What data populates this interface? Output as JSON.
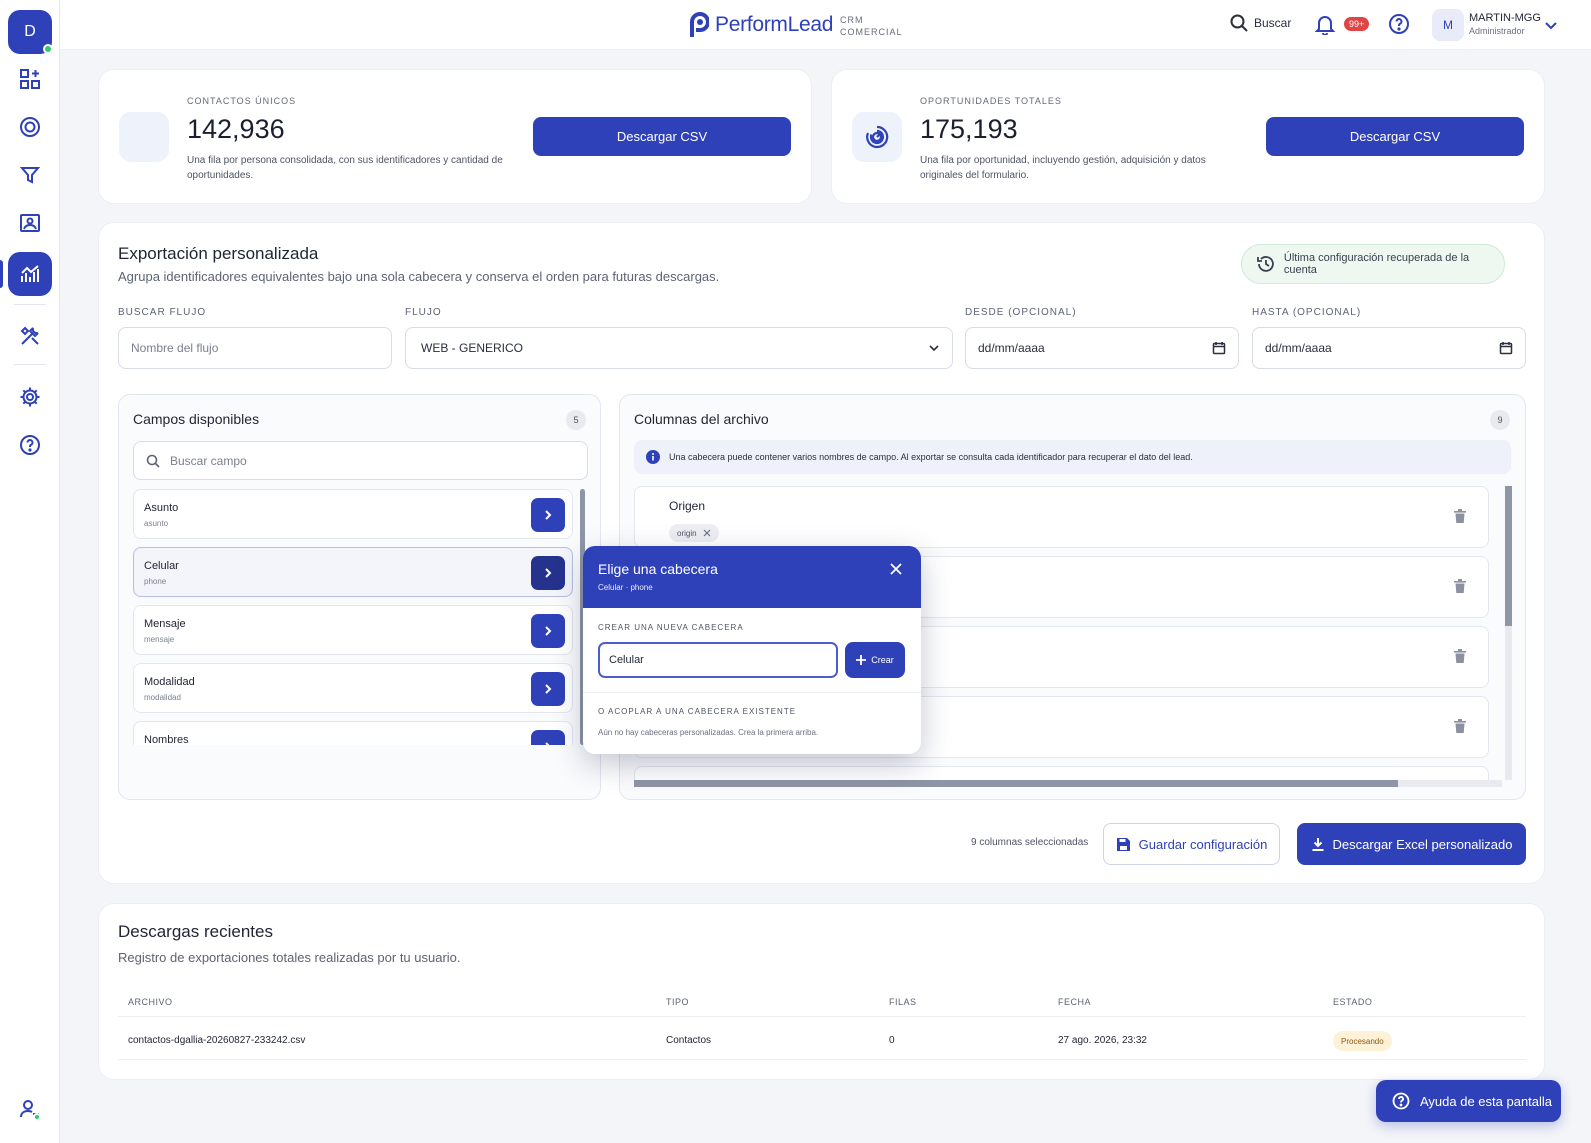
{
  "sidebar": {
    "avatar_letter": "D"
  },
  "topbar": {
    "brand": "PerformLead",
    "brand_sub_1": "CRM",
    "brand_sub_2": "COMERCIAL",
    "search_label": "Buscar",
    "notif_badge": "99+",
    "user_initial": "M",
    "user_name": "MARTIN-MGG",
    "user_role": "Administrador"
  },
  "stats": [
    {
      "label": "CONTACTOS ÚNICOS",
      "value": "142,936",
      "description": "Una fila por persona consolidada, con sus identificadores y cantidad de oportunidades.",
      "button": "Descargar CSV"
    },
    {
      "label": "OPORTUNIDADES TOTALES",
      "value": "175,193",
      "description": "Una fila por oportunidad, incluyendo gestión, adquisición y datos originales del formulario.",
      "button": "Descargar CSV"
    }
  ],
  "custom_export": {
    "title": "Exportación personalizada",
    "subtitle": "Agrupa identificadores equivalentes bajo una sola cabecera y conserva el orden para futuras descargas.",
    "restored_note": "Última configuración recuperada de la cuenta",
    "filters": {
      "search_flow_label": "BUSCAR FLUJO",
      "search_flow_placeholder": "Nombre del flujo",
      "flow_label": "FLUJO",
      "flow_value": "WEB - GENERICO",
      "from_label": "DESDE (OPCIONAL)",
      "from_value": "dd/mm/aaaa",
      "to_label": "HASTA (OPCIONAL)",
      "to_value": "dd/mm/aaaa"
    },
    "available": {
      "title": "Campos disponibles",
      "count": "5",
      "search_placeholder": "Buscar campo",
      "items": [
        {
          "name": "Asunto",
          "key": "asunto"
        },
        {
          "name": "Celular",
          "key": "phone"
        },
        {
          "name": "Mensaje",
          "key": "mensaje"
        },
        {
          "name": "Modalidad",
          "key": "modalidad"
        },
        {
          "name": "Nombres",
          "key": ""
        }
      ]
    },
    "columns": {
      "title": "Columnas del archivo",
      "count": "9",
      "info": "Una cabecera puede contener varios nombres de campo. Al exportar se consulta cada identificador para recuperar el dato del lead.",
      "first_header": "Origen",
      "first_chip": "origin"
    },
    "selected_count": "9 columnas seleccionadas",
    "save_button": "Guardar configuración",
    "download_button": "Descargar Excel personalizado"
  },
  "popover": {
    "title": "Elige una cabecera",
    "subtitle": "Celular · phone",
    "new_label": "CREAR UNA NUEVA CABECERA",
    "new_value": "Celular",
    "create_button": "Crear",
    "existing_label": "O ACOPLAR A UNA CABECERA EXISTENTE",
    "existing_empty": "Aún no hay cabeceras personalizadas. Crea la primera arriba."
  },
  "recent": {
    "title": "Descargas recientes",
    "subtitle": "Registro de exportaciones totales realizadas por tu usuario.",
    "headers": [
      "ARCHIVO",
      "TIPO",
      "FILAS",
      "FECHA",
      "ESTADO"
    ],
    "rows": [
      {
        "file": "contactos-dgallia-20260827-233242.csv",
        "type": "Contactos",
        "rows": "0",
        "date": "27 ago. 2026, 23:32",
        "status": "Procesando"
      }
    ]
  },
  "help_button": "Ayuda de esta pantalla",
  "colors": {
    "accent": "#2f41b8",
    "success": "#2ecc71",
    "danger": "#e04545"
  }
}
